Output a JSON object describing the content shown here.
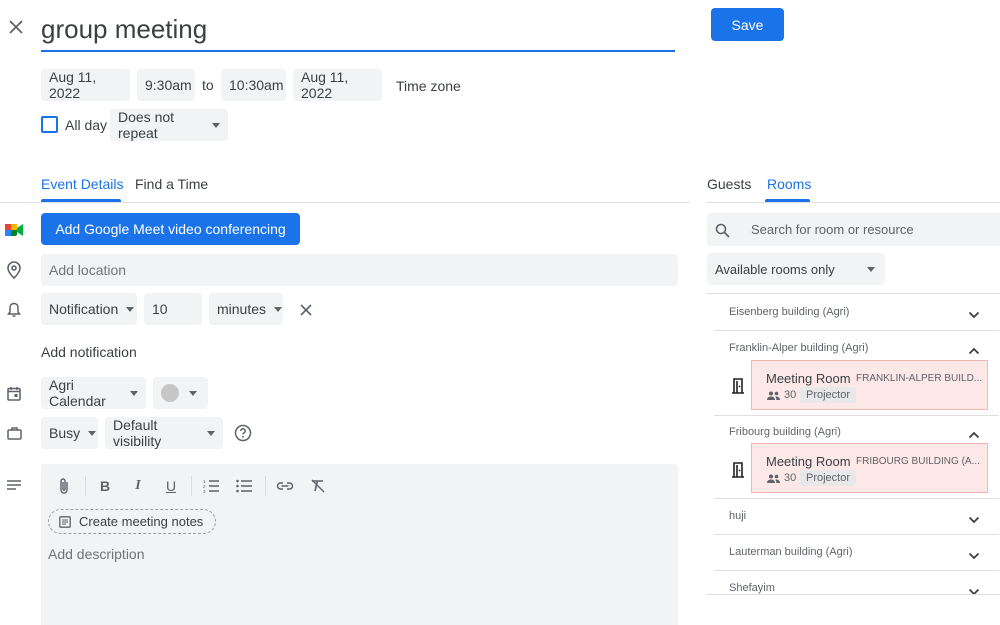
{
  "title": {
    "value": "group meeting"
  },
  "save_label": "Save",
  "datetime": {
    "start_date": "Aug 11, 2022",
    "start_time": "9:30am",
    "to": "to",
    "end_time": "10:30am",
    "end_date": "Aug 11, 2022",
    "timezone": "Time zone"
  },
  "allday": {
    "label": "All day",
    "repeat": "Does not repeat"
  },
  "tabs": {
    "event_details": "Event Details",
    "find_time": "Find a Time"
  },
  "meet_button": "Add Google Meet video conferencing",
  "location_placeholder": "Add location",
  "notification": {
    "type": "Notification",
    "value": "10",
    "unit": "minutes"
  },
  "add_notification": "Add notification",
  "calendar": {
    "name": "Agri Calendar"
  },
  "status": {
    "busy": "Busy",
    "visibility": "Default visibility"
  },
  "editor": {
    "notes_button": "Create meeting notes",
    "description_placeholder": "Add description"
  },
  "right_tabs": {
    "guests": "Guests",
    "rooms": "Rooms"
  },
  "room_search_placeholder": "Search for room or resource",
  "room_filter": "Available rooms only",
  "buildings": [
    {
      "name": "Eisenberg building (Agri)"
    },
    {
      "name": "Franklin-Alper building (Agri)"
    },
    {
      "name": "Fribourg building (Agri)"
    },
    {
      "name": "huji"
    },
    {
      "name": "Lauterman building (Agri)"
    },
    {
      "name": "Shefayim"
    }
  ],
  "rooms": [
    {
      "name": "Meeting Room",
      "building": "FRANKLIN-ALPER BUILD...",
      "capacity": "30",
      "feature": "Projector"
    },
    {
      "name": "Meeting Room",
      "building": "FRIBOURG BUILDING (A...",
      "capacity": "30",
      "feature": "Projector"
    }
  ],
  "colors": {
    "accent": "#1a73e8",
    "chip_bg": "#f1f3f4",
    "room_busy_bg": "#fce8e6"
  }
}
